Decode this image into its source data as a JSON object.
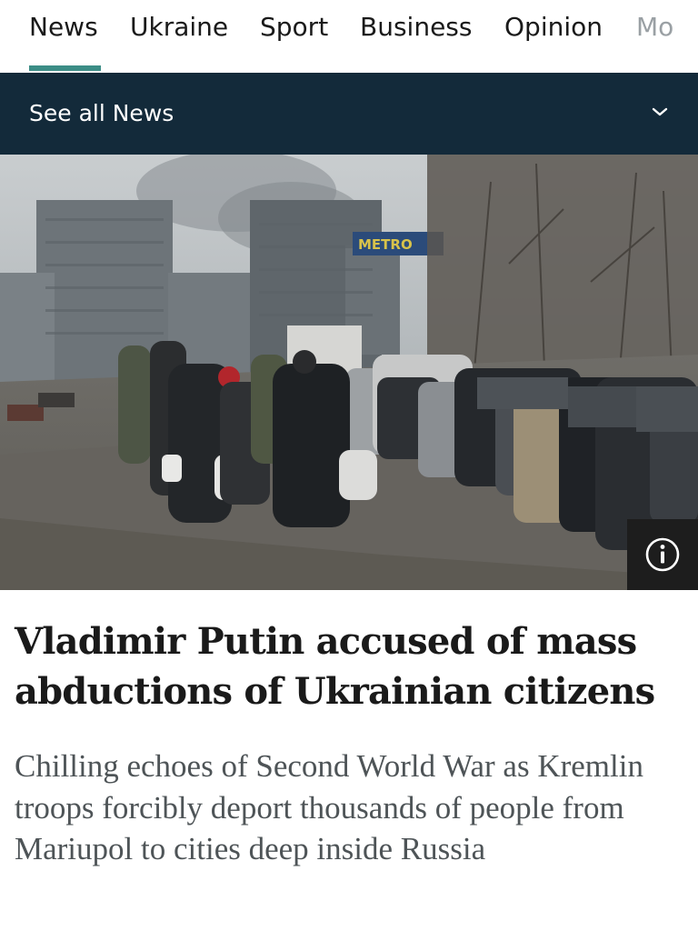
{
  "nav": {
    "tabs": [
      {
        "label": "News",
        "active": true
      },
      {
        "label": "Ukraine"
      },
      {
        "label": "Sport"
      },
      {
        "label": "Business"
      },
      {
        "label": "Opinion"
      },
      {
        "label": "Mo"
      }
    ],
    "accent_color": "#3c8d86"
  },
  "section_bar": {
    "label": "See all News",
    "icon": "chevron-down-icon",
    "background": "#132a3a"
  },
  "hero": {
    "sign_text": "METRO",
    "info_icon": "info-icon"
  },
  "article": {
    "headline": "Vladimir Putin accused of mass abductions of Ukrainian citizens",
    "standfirst": "Chilling echoes of Second World War as Kremlin troops forcibly deport thousands of people from Mariupol to cities deep inside Russia"
  }
}
